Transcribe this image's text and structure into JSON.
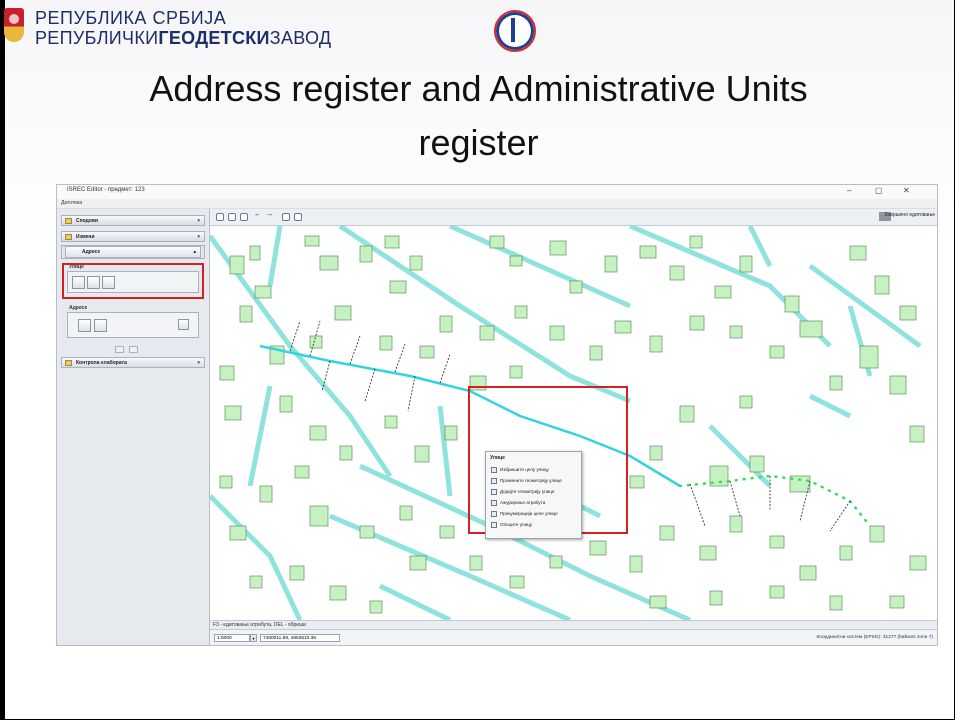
{
  "header": {
    "institution_line1": "РЕПУБЛИКА СРБИЈА",
    "institution_line2_prefix": "РЕПУБЛИЧКИ",
    "institution_line2_bold": "ГЕОДЕТСКИ",
    "institution_line2_suffix": "ЗАВОД"
  },
  "slide_title_line1": "Address register and Administrative Units",
  "slide_title_line2": "register",
  "app": {
    "window_title": "ISREC Editor - предмет: 123",
    "menu_item": "Датотека",
    "left_panel": {
      "sections": [
        {
          "label": "Сподови"
        },
        {
          "label": "Измени"
        },
        {
          "label": "Контрола елабората"
        }
      ],
      "subsection": "Адресе",
      "streets_group_label": "Улице",
      "addresses_group_label": "Адресе"
    },
    "toolbar": {
      "finish_label": "Завршено едитовање"
    },
    "context_menu": {
      "title": "Улице",
      "items": [
        "Избришите целу улицу",
        "Промените геометрију улице",
        "Додајте геометрију улице",
        "Ажурирање атрибута",
        "Прекумерација целе улице",
        "Опоците улицу"
      ]
    },
    "status": {
      "hint": "F3 - едитовање атрибута, DEL - обриши",
      "scale": "1:5000",
      "coordinates": "7460011.89, 4853510.36",
      "crs": "Координатни систем (EPSG): 31277 (balkans zone 7)"
    }
  },
  "colors": {
    "building_fill": "#c6f2c2",
    "building_stroke": "#4b7d4b",
    "street_fill": "#8fe3dd",
    "highlight": "#d42020",
    "line_cyan": "#33d3e0",
    "line_green": "#2ee05a"
  }
}
